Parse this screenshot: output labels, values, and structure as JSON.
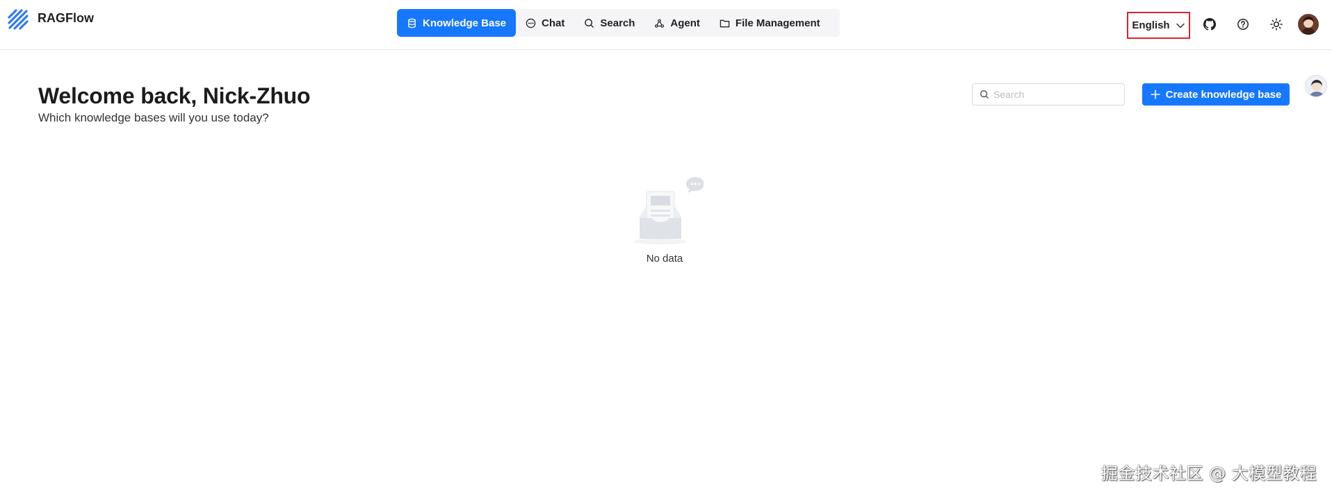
{
  "app": {
    "name": "RAGFlow",
    "logo_icon": "ragflow-logo-icon",
    "brand_color": "#1677ff"
  },
  "nav": {
    "items": [
      {
        "label": "Knowledge Base",
        "icon": "database-icon",
        "active": true
      },
      {
        "label": "Chat",
        "icon": "chat-bubble-icon",
        "active": false
      },
      {
        "label": "Search",
        "icon": "search-icon",
        "active": false
      },
      {
        "label": "Agent",
        "icon": "agent-graph-icon",
        "active": false
      },
      {
        "label": "File Management",
        "icon": "folder-icon",
        "active": false
      }
    ]
  },
  "header": {
    "language": "English",
    "icons": [
      "github-icon",
      "help-icon",
      "theme-sun-icon"
    ],
    "highlight_color": "#d9242b"
  },
  "main": {
    "welcome": "Welcome back, Nick-Zhuo",
    "subtitle": "Which knowledge bases will you use today?",
    "search_placeholder": "Search",
    "create_button": "Create knowledge base",
    "empty_text": "No data"
  },
  "watermark": "掘金技术社区 @ 大模型教程"
}
